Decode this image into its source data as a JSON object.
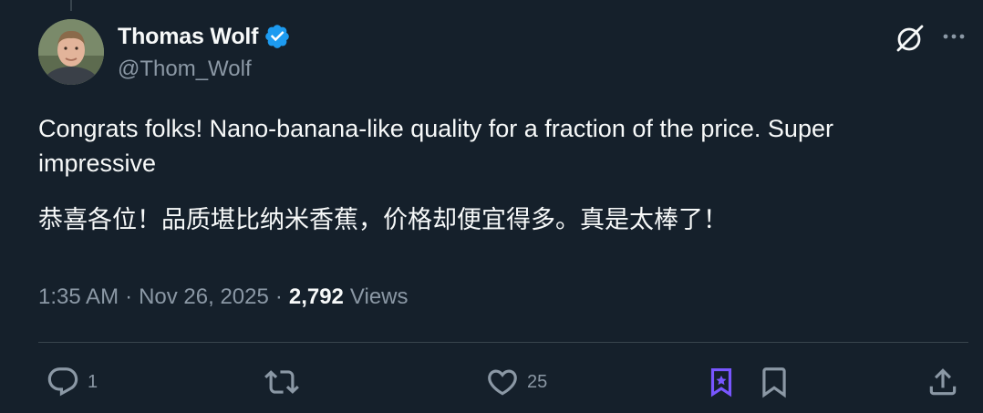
{
  "author": {
    "display_name": "Thomas Wolf",
    "handle": "@Thom_Wolf",
    "verified": true
  },
  "post": {
    "text_en": "Congrats folks! Nano-banana-like quality for a fraction of the price. Super impressive",
    "text_zh": "恭喜各位！品质堪比纳米香蕉，价格却便宜得多。真是太棒了！"
  },
  "meta": {
    "time": "1:35 AM",
    "separator": "·",
    "date": "Nov 26, 2025",
    "views_count": "2,792",
    "views_label": "Views"
  },
  "actions": {
    "reply_count": "1",
    "repost_count": "",
    "like_count": "25"
  },
  "icons": {
    "verified": "verified-badge-icon",
    "grok": "grok-icon",
    "more": "more-dots-icon",
    "reply": "reply-icon",
    "repost": "repost-icon",
    "like": "heart-icon",
    "grok_bookmark": "grok-bookmark-icon",
    "bookmark": "bookmark-icon",
    "share": "share-icon"
  },
  "colors": {
    "background": "#15202b",
    "text_primary": "#f7f9f9",
    "text_secondary": "#8b98a5",
    "verified_blue": "#1d9bf0",
    "grok_purple": "#7856ff",
    "divider": "#38444d"
  }
}
